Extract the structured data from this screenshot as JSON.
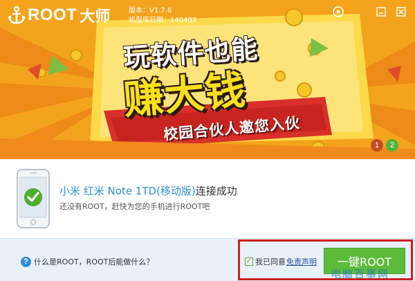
{
  "app": {
    "logo_text": "ROOT",
    "logo_cn": "大师",
    "version_label": "版本：V1.7.6",
    "db_date_label": "机型库日期：140403"
  },
  "banner": {
    "headline_line1": "玩软件也能",
    "headline_line2": "赚大钱",
    "ribbon": "校园合伙人邀您入伙",
    "pager": [
      "1",
      "2"
    ],
    "active_page": "2",
    "colors": {
      "bg": "#f19a1a",
      "ribbon": "#d9302b",
      "text_yellow": "#ffe01a"
    }
  },
  "device": {
    "model": "小米 红米 Note 1TD(移动版)",
    "status": "连接成功",
    "hint": "还没有ROOT，赶快为您的手机进行ROOT吧"
  },
  "footer": {
    "help_text": "什么是ROOT，ROOT后能做什么？",
    "agree_prefix": "我已同意",
    "disclaimer_link": "免责声明",
    "root_button": "一键ROOT",
    "watermark": "电脑百事网",
    "colors": {
      "button": "#5dbb3c",
      "highlight_border": "#cc1f1f"
    }
  },
  "icons": [
    "anchor-logo-icon",
    "eye-icon",
    "minimize-icon",
    "close-icon",
    "phone-icon",
    "check-icon",
    "help-icon"
  ]
}
